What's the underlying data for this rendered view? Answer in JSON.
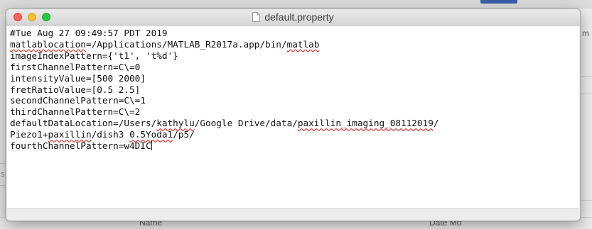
{
  "background": {
    "right_letter": "m",
    "left_letter": "s",
    "bottom_name_label": "Name",
    "bottom_date_label": "Date Mo"
  },
  "window": {
    "title": "default.property",
    "title_icon": "document-icon"
  },
  "editor": {
    "lines": [
      {
        "segments": [
          {
            "text": "#Tue Aug 27 09:49:57 PDT 2019",
            "sq": false
          }
        ]
      },
      {
        "segments": [
          {
            "text": "matlablocation",
            "sq": true
          },
          {
            "text": "=/Applications/MATLAB_R2017a.app/bin/",
            "sq": false
          },
          {
            "text": "matlab",
            "sq": true
          }
        ]
      },
      {
        "segments": [
          {
            "text": "imageIndexPattern={'t1', 't%d'}",
            "sq": false
          }
        ]
      },
      {
        "segments": [
          {
            "text": "firstChannelPattern=C\\=0",
            "sq": false
          }
        ]
      },
      {
        "segments": [
          {
            "text": "intensityValue=[500 2000]",
            "sq": false
          }
        ]
      },
      {
        "segments": [
          {
            "text": "fretRatioValue=[0.5 2.5]",
            "sq": false
          }
        ]
      },
      {
        "segments": [
          {
            "text": "secondChannelPattern=C\\=1",
            "sq": false
          }
        ]
      },
      {
        "segments": [
          {
            "text": "thirdChannelPattern=C\\=2",
            "sq": false
          }
        ]
      },
      {
        "segments": [
          {
            "text": "defaultDataLocation=/Users/",
            "sq": false
          },
          {
            "text": "kathylu",
            "sq": true
          },
          {
            "text": "/Google Drive/data/",
            "sq": false
          },
          {
            "text": "paxillin_imaging_08112019",
            "sq": true
          },
          {
            "text": "/",
            "sq": false
          }
        ]
      },
      {
        "segments": [
          {
            "text": "Piezo1+",
            "sq": false
          },
          {
            "text": "paxillin",
            "sq": true
          },
          {
            "text": "/dish3 ",
            "sq": false
          },
          {
            "text": "0.5Yoda1",
            "sq": true
          },
          {
            "text": "/p5/",
            "sq": false
          }
        ]
      },
      {
        "segments": [
          {
            "text": "fourthChannelPattern=w4DIC",
            "sq": false
          }
        ],
        "cursor": true
      }
    ]
  },
  "colors": {
    "close": "#fc5f57",
    "minimize": "#fdbc2e",
    "maximize": "#28c840",
    "spellcheck": "#e04040"
  }
}
